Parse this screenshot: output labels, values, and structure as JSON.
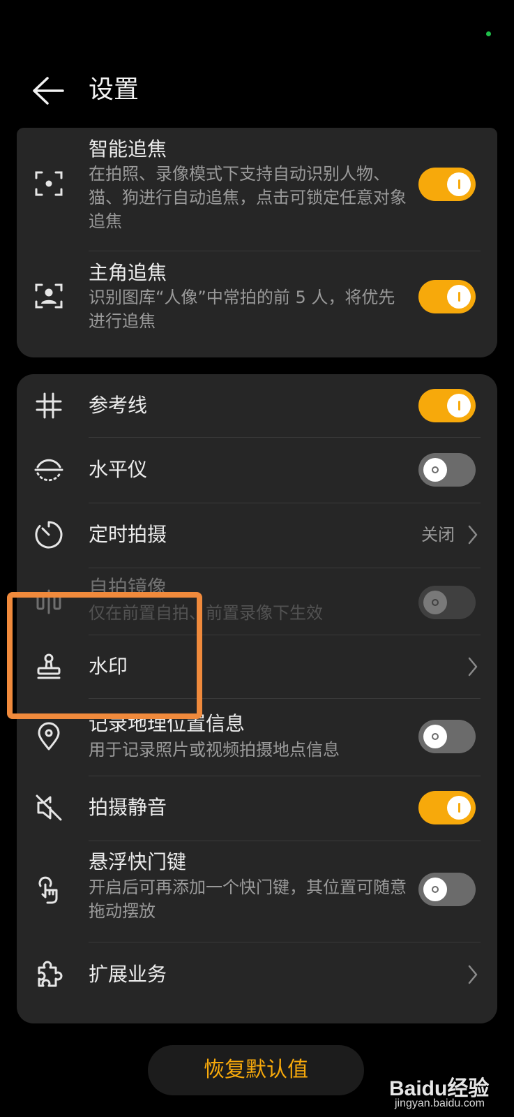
{
  "header": {
    "title": "设置"
  },
  "card1": {
    "items": [
      {
        "title": "智能追焦",
        "subtitle": "在拍照、录像模式下支持自动识别人物、猫、狗进行自动追焦，点击可锁定任意对象追焦",
        "toggle": true,
        "icon": "focus-frame-icon"
      },
      {
        "title": "主角追焦",
        "subtitle": "识别图库“人像”中常拍的前 5 人，将优先进行追焦",
        "toggle": true,
        "icon": "portrait-focus-icon"
      }
    ]
  },
  "card2": {
    "items": [
      {
        "title": "参考线",
        "toggle": true,
        "icon": "grid-icon"
      },
      {
        "title": "水平仪",
        "toggle": false,
        "icon": "level-icon"
      },
      {
        "title": "定时拍摄",
        "value": "关闭",
        "icon": "timer-icon"
      },
      {
        "title": "自拍镜像",
        "subtitle": "仅在前置自拍、前置录像下生效",
        "toggle": false,
        "disabled": true,
        "icon": "mirror-icon"
      },
      {
        "title": "水印",
        "icon": "stamp-icon"
      },
      {
        "title": "记录地理位置信息",
        "subtitle": "用于记录照片或视频拍摄地点信息",
        "toggle": false,
        "icon": "location-icon"
      },
      {
        "title": "拍摄静音",
        "toggle": true,
        "icon": "mute-icon"
      },
      {
        "title": "悬浮快门键",
        "subtitle": "开启后可再添加一个快门键，其位置可随意拖动摆放",
        "toggle": false,
        "icon": "touch-icon"
      },
      {
        "title": "扩展业务",
        "icon": "puzzle-icon"
      }
    ]
  },
  "reset_button": "恢复默认值",
  "watermark": {
    "main": "Baidu经验",
    "sub": "jingyan.baidu.com"
  },
  "colors": {
    "accent": "#f7a90b",
    "highlight": "#f08a3c",
    "card": "#262626"
  }
}
